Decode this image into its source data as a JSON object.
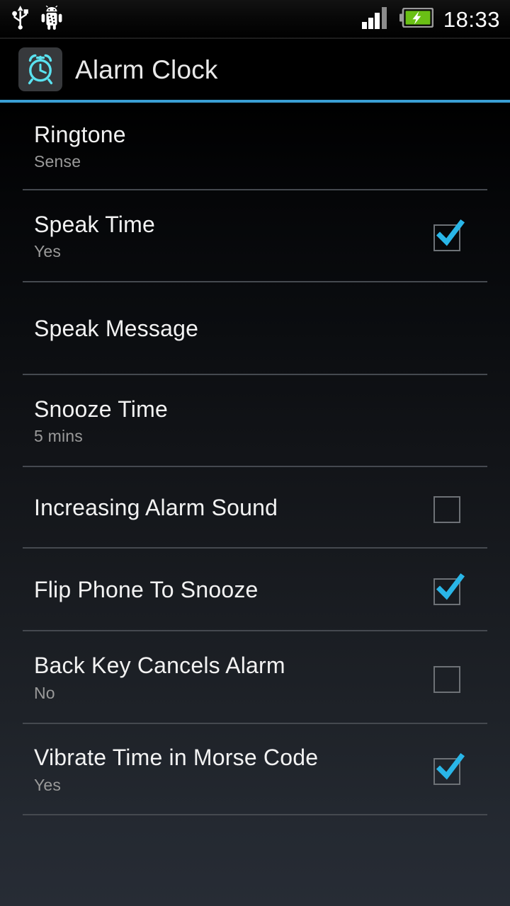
{
  "status_bar": {
    "time": "18:33",
    "left_icons": [
      {
        "name": "usb-icon",
        "label": "USB connected"
      },
      {
        "name": "android-debug-icon",
        "label": "USB debugging connected"
      }
    ],
    "signal": {
      "name": "signal-bars-icon",
      "bars_filled": 3,
      "bars_total": 4
    },
    "battery": {
      "name": "battery-charging-icon",
      "state": "charging",
      "color": "#6ac015"
    }
  },
  "action_bar": {
    "title": "Alarm Clock",
    "icon": "alarm-clock-icon",
    "icon_color": "#5ae2f0",
    "accent_color": "#3a9fd4"
  },
  "settings": {
    "rows": [
      {
        "title": "Ringtone",
        "summary": "Sense",
        "checkbox": null
      },
      {
        "title": "Speak Time",
        "summary": "Yes",
        "checkbox": true
      },
      {
        "title": "Speak Message",
        "summary": "",
        "checkbox": null
      },
      {
        "title": "Snooze Time",
        "summary": "5 mins",
        "checkbox": null
      },
      {
        "title": "Increasing Alarm Sound",
        "summary": "",
        "checkbox": false
      },
      {
        "title": "Flip Phone To Snooze",
        "summary": "",
        "checkbox": true
      },
      {
        "title": "Back Key Cancels Alarm",
        "summary": "No",
        "checkbox": false
      },
      {
        "title": "Vibrate Time in Morse Code",
        "summary": "Yes",
        "checkbox": true
      }
    ]
  },
  "colors": {
    "accent": "#3a9fd4",
    "check": "#29b6e8",
    "title_text": "#f2f2f2",
    "summary_text": "#9a9a9a",
    "divider": "#45494f",
    "background_top": "#000000",
    "background_bottom": "#272c35"
  }
}
